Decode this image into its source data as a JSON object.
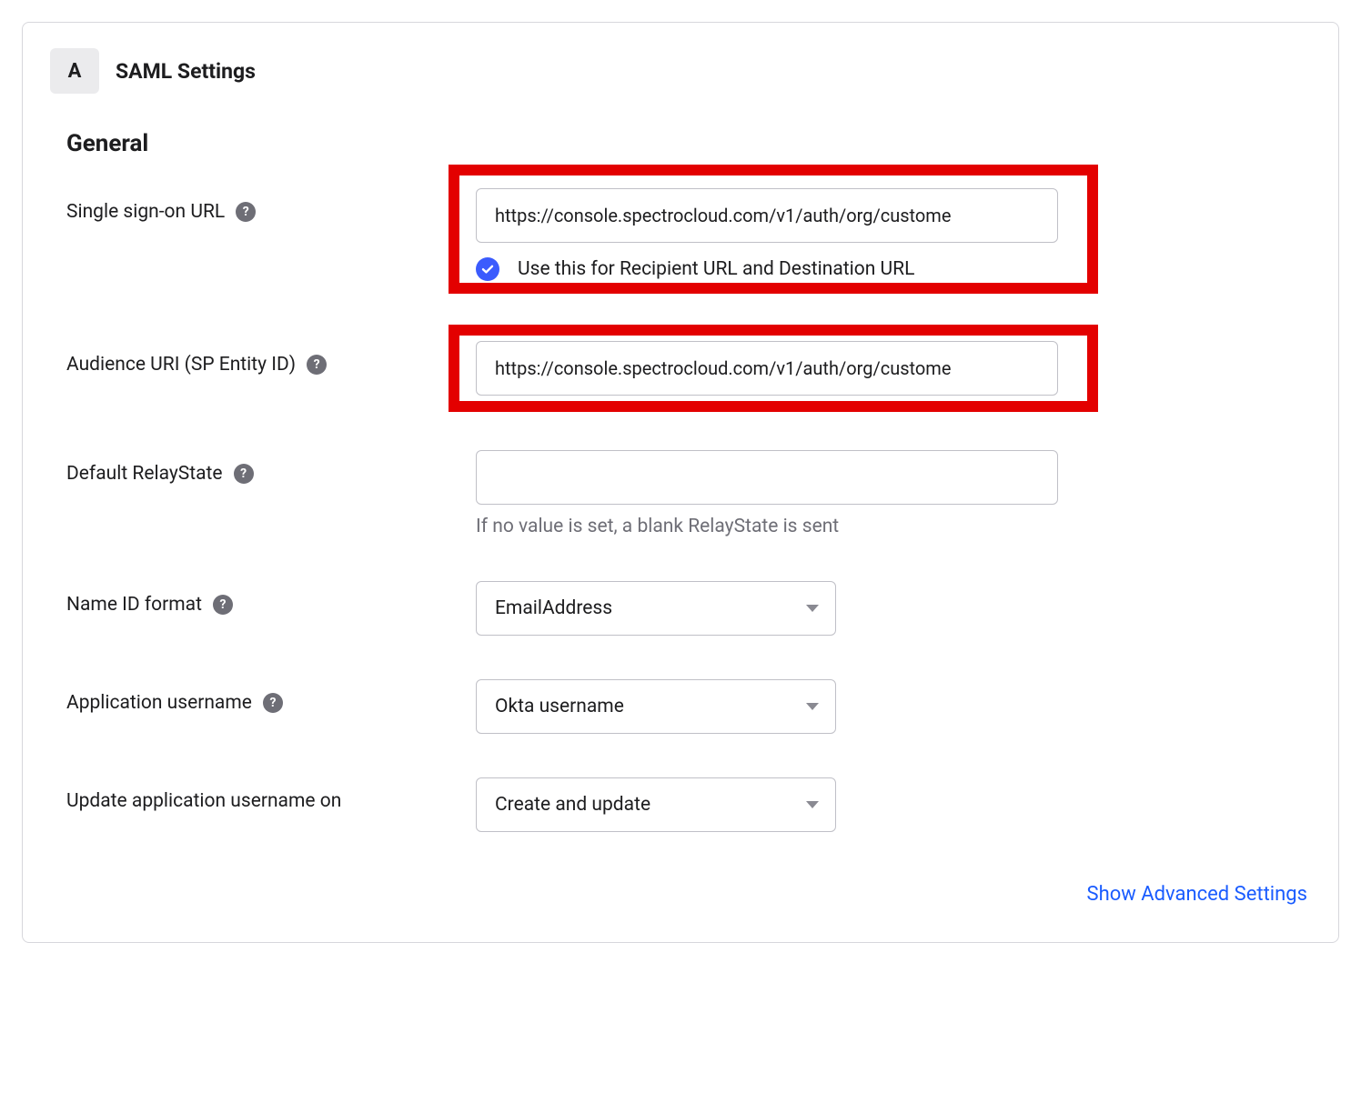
{
  "step_letter": "A",
  "panel_title": "SAML Settings",
  "section_title": "General",
  "fields": {
    "sso_url": {
      "label": "Single sign-on URL",
      "value": "https://console.spectrocloud.com/v1/auth/org/custome",
      "checkbox_label": "Use this for Recipient URL and Destination URL"
    },
    "audience_uri": {
      "label": "Audience URI (SP Entity ID)",
      "value": "https://console.spectrocloud.com/v1/auth/org/custome"
    },
    "relay_state": {
      "label": "Default RelayState",
      "value": "",
      "hint": "If no value is set, a blank RelayState is sent"
    },
    "name_id_format": {
      "label": "Name ID format",
      "value": "EmailAddress"
    },
    "app_username": {
      "label": "Application username",
      "value": "Okta username"
    },
    "update_on": {
      "label": "Update application username on",
      "value": "Create and update"
    }
  },
  "advanced_link": "Show Advanced Settings",
  "help_glyph": "?"
}
